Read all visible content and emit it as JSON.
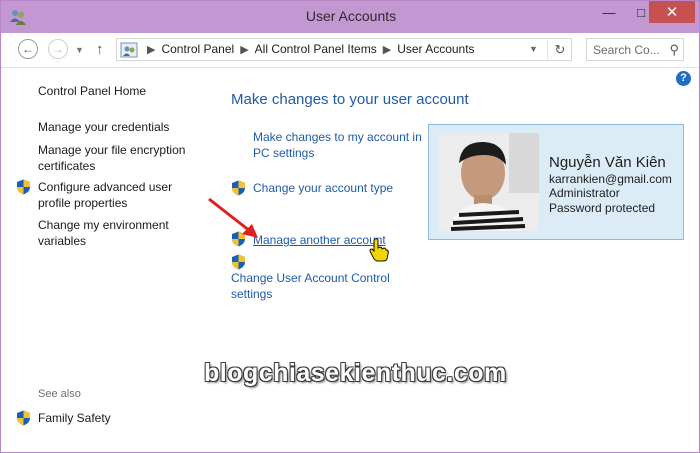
{
  "window": {
    "title": "User Accounts",
    "controls": {
      "minimize": "—",
      "maximize": "□",
      "close": "✕"
    }
  },
  "nav": {
    "breadcrumbs": [
      "Control Panel",
      "All Control Panel Items",
      "User Accounts"
    ],
    "search_placeholder": "Search Co..."
  },
  "sidebar": {
    "items": [
      {
        "label": "Control Panel Home",
        "shield": false
      },
      {
        "label": "Manage your credentials",
        "shield": false
      },
      {
        "label": "Manage your file encryption certificates",
        "shield": false
      },
      {
        "label": "Configure advanced user profile properties",
        "shield": true
      },
      {
        "label": "Change my environment variables",
        "shield": false
      }
    ],
    "see_also_label": "See also",
    "see_also": [
      {
        "label": "Family Safety",
        "shield": true
      }
    ]
  },
  "main": {
    "heading": "Make changes to your user account",
    "links": [
      {
        "label": "Make changes to my account in PC settings",
        "shield": false
      },
      {
        "label": "Change your account type",
        "shield": true
      },
      {
        "label": "Manage another account",
        "shield": true
      },
      {
        "label": "Change User Account Control settings",
        "shield": true
      }
    ]
  },
  "account": {
    "name": "Nguyễn Văn Kiên",
    "email": "karrankien@gmail.com",
    "role": "Administrator",
    "status": "Password protected"
  },
  "watermark": "blogchiasekienthuc.com",
  "colors": {
    "titlebar": "#c398d2",
    "link": "#1e5ba7",
    "card_bg": "#dcecf7",
    "close_button": "#c75050",
    "arrow": "#e02020"
  }
}
